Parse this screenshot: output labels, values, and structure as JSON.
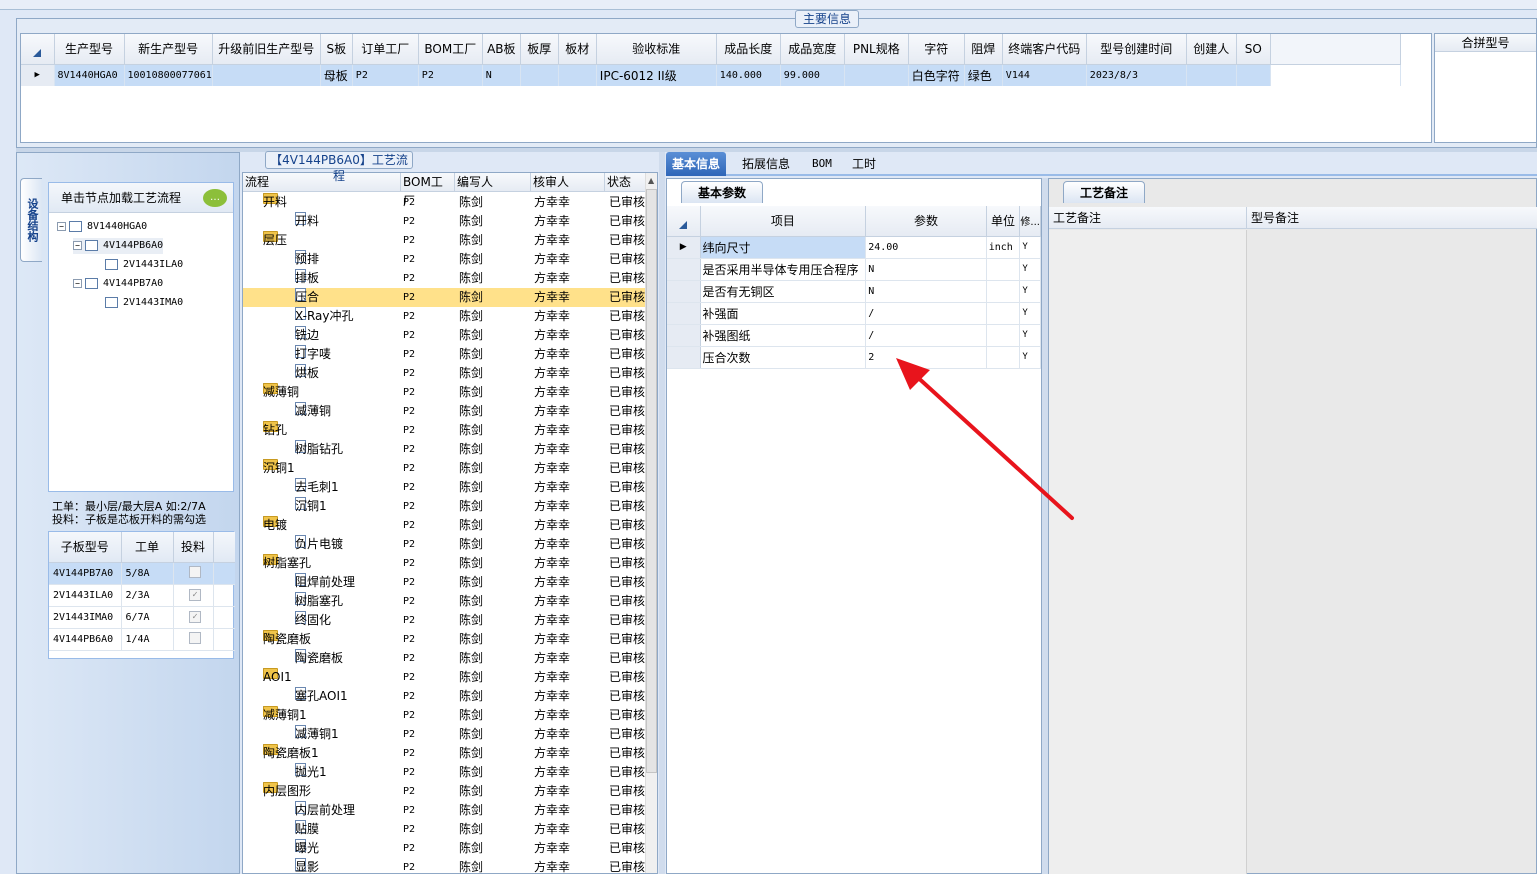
{
  "main_info": {
    "legend": "主要信息",
    "columns": [
      "生产型号",
      "新生产型号",
      "升级前旧生产型号",
      "S板",
      "订单工厂",
      "BOM工厂",
      "AB板",
      "板厚",
      "板材",
      "验收标准",
      "成品长度",
      "成品宽度",
      "PNL规格",
      "字符",
      "阻焊",
      "终端客户代码",
      "型号创建时间",
      "创建人",
      "SO"
    ],
    "row": [
      "8V1440HGA0",
      "10010800077061",
      "",
      "母板",
      "P2",
      "P2",
      "N",
      "",
      "",
      "IPC-6012 II级",
      "140.000",
      "99.000",
      "",
      "白色字符",
      "绿色",
      "V144",
      "2023/8/3",
      "",
      ""
    ],
    "merge_header": "合拼型号"
  },
  "left": {
    "vtab": "设备结构",
    "tree_header": "单击节点加载工艺流程",
    "tree": [
      "8V1440HGA0",
      "4V144PB6A0",
      "2V1443ILA0",
      "4V144PB7A0",
      "2V1443IMA0"
    ],
    "note_line1": "工单：最小层/最大层A 如:2/7A",
    "note_line2": "投料：子板是芯板开料的需勾选",
    "sub_columns": [
      "子板型号",
      "工单",
      "投料"
    ],
    "sub_rows": [
      {
        "model": "4V144PB7A0",
        "order": "5/8A",
        "checked": false
      },
      {
        "model": "2V1443ILA0",
        "order": "2/3A",
        "checked": true
      },
      {
        "model": "2V1443IMA0",
        "order": "6/7A",
        "checked": true
      },
      {
        "model": "4V144PB6A0",
        "order": "1/4A",
        "checked": false
      }
    ]
  },
  "flow": {
    "legend": "【4V144PB6A0】工艺流程",
    "columns": [
      "流程",
      "BOM工厂",
      "编写人",
      "核审人",
      "状态"
    ],
    "factory": "P2",
    "writer": "陈剑",
    "reviewer": "方幸幸",
    "status": "已审核",
    "rows": [
      {
        "name": "开料",
        "level": 0
      },
      {
        "name": "开料",
        "level": 1
      },
      {
        "name": "层压",
        "level": 0
      },
      {
        "name": "预排",
        "level": 1
      },
      {
        "name": "排板",
        "level": 1
      },
      {
        "name": "压合",
        "level": 1,
        "selected": true
      },
      {
        "name": "X-Ray冲孔",
        "level": 1
      },
      {
        "name": "铣边",
        "level": 1
      },
      {
        "name": "打字唛",
        "level": 1
      },
      {
        "name": "烘板",
        "level": 1
      },
      {
        "name": "减薄铜",
        "level": 0
      },
      {
        "name": "减薄铜",
        "level": 1
      },
      {
        "name": "钻孔",
        "level": 0
      },
      {
        "name": "树脂钻孔",
        "level": 1
      },
      {
        "name": "沉铜1",
        "level": 0
      },
      {
        "name": "去毛刺1",
        "level": 1
      },
      {
        "name": "沉铜1",
        "level": 1
      },
      {
        "name": "电镀",
        "level": 0
      },
      {
        "name": "负片电镀",
        "level": 1
      },
      {
        "name": "树脂塞孔",
        "level": 0
      },
      {
        "name": "阻焊前处理",
        "level": 1
      },
      {
        "name": "树脂塞孔",
        "level": 1
      },
      {
        "name": "终固化",
        "level": 1
      },
      {
        "name": "陶瓷磨板",
        "level": 0
      },
      {
        "name": "陶瓷磨板",
        "level": 1
      },
      {
        "name": "AOI1",
        "level": 0
      },
      {
        "name": "塞孔AOI1",
        "level": 1
      },
      {
        "name": "减薄铜1",
        "level": 0
      },
      {
        "name": "减薄铜1",
        "level": 1
      },
      {
        "name": "陶瓷磨板1",
        "level": 0
      },
      {
        "name": "抛光1",
        "level": 1
      },
      {
        "name": "内层图形",
        "level": 0
      },
      {
        "name": "内层前处理",
        "level": 1
      },
      {
        "name": "贴膜",
        "level": 1
      },
      {
        "name": "曝光",
        "level": 1
      },
      {
        "name": "显影",
        "level": 1
      }
    ]
  },
  "right": {
    "tabs": [
      "基本信息",
      "拓展信息",
      "BOM",
      "工时"
    ],
    "section": "基本参数",
    "param_columns": [
      "项目",
      "参数",
      "单位",
      "修..."
    ],
    "params": [
      {
        "item": "纬向尺寸",
        "value": "24.00",
        "unit": "inch",
        "mod": "Y"
      },
      {
        "item": "是否采用半导体专用压合程序",
        "value": "N",
        "unit": "",
        "mod": "Y"
      },
      {
        "item": "是否有无铜区",
        "value": "N",
        "unit": "",
        "mod": "Y"
      },
      {
        "item": "补强面",
        "value": "/",
        "unit": "",
        "mod": "Y"
      },
      {
        "item": "补强图纸",
        "value": "/",
        "unit": "",
        "mod": "Y"
      },
      {
        "item": "压合次数",
        "value": "2",
        "unit": "",
        "mod": "Y"
      }
    ],
    "remark_section": "工艺备注",
    "remark_columns": [
      "工艺备注",
      "型号备注"
    ]
  },
  "colors": {
    "arrow": "#e8141c",
    "selection": "#c6dcf6",
    "highlight": "#ffe18a",
    "accent": "#2f66b8"
  }
}
